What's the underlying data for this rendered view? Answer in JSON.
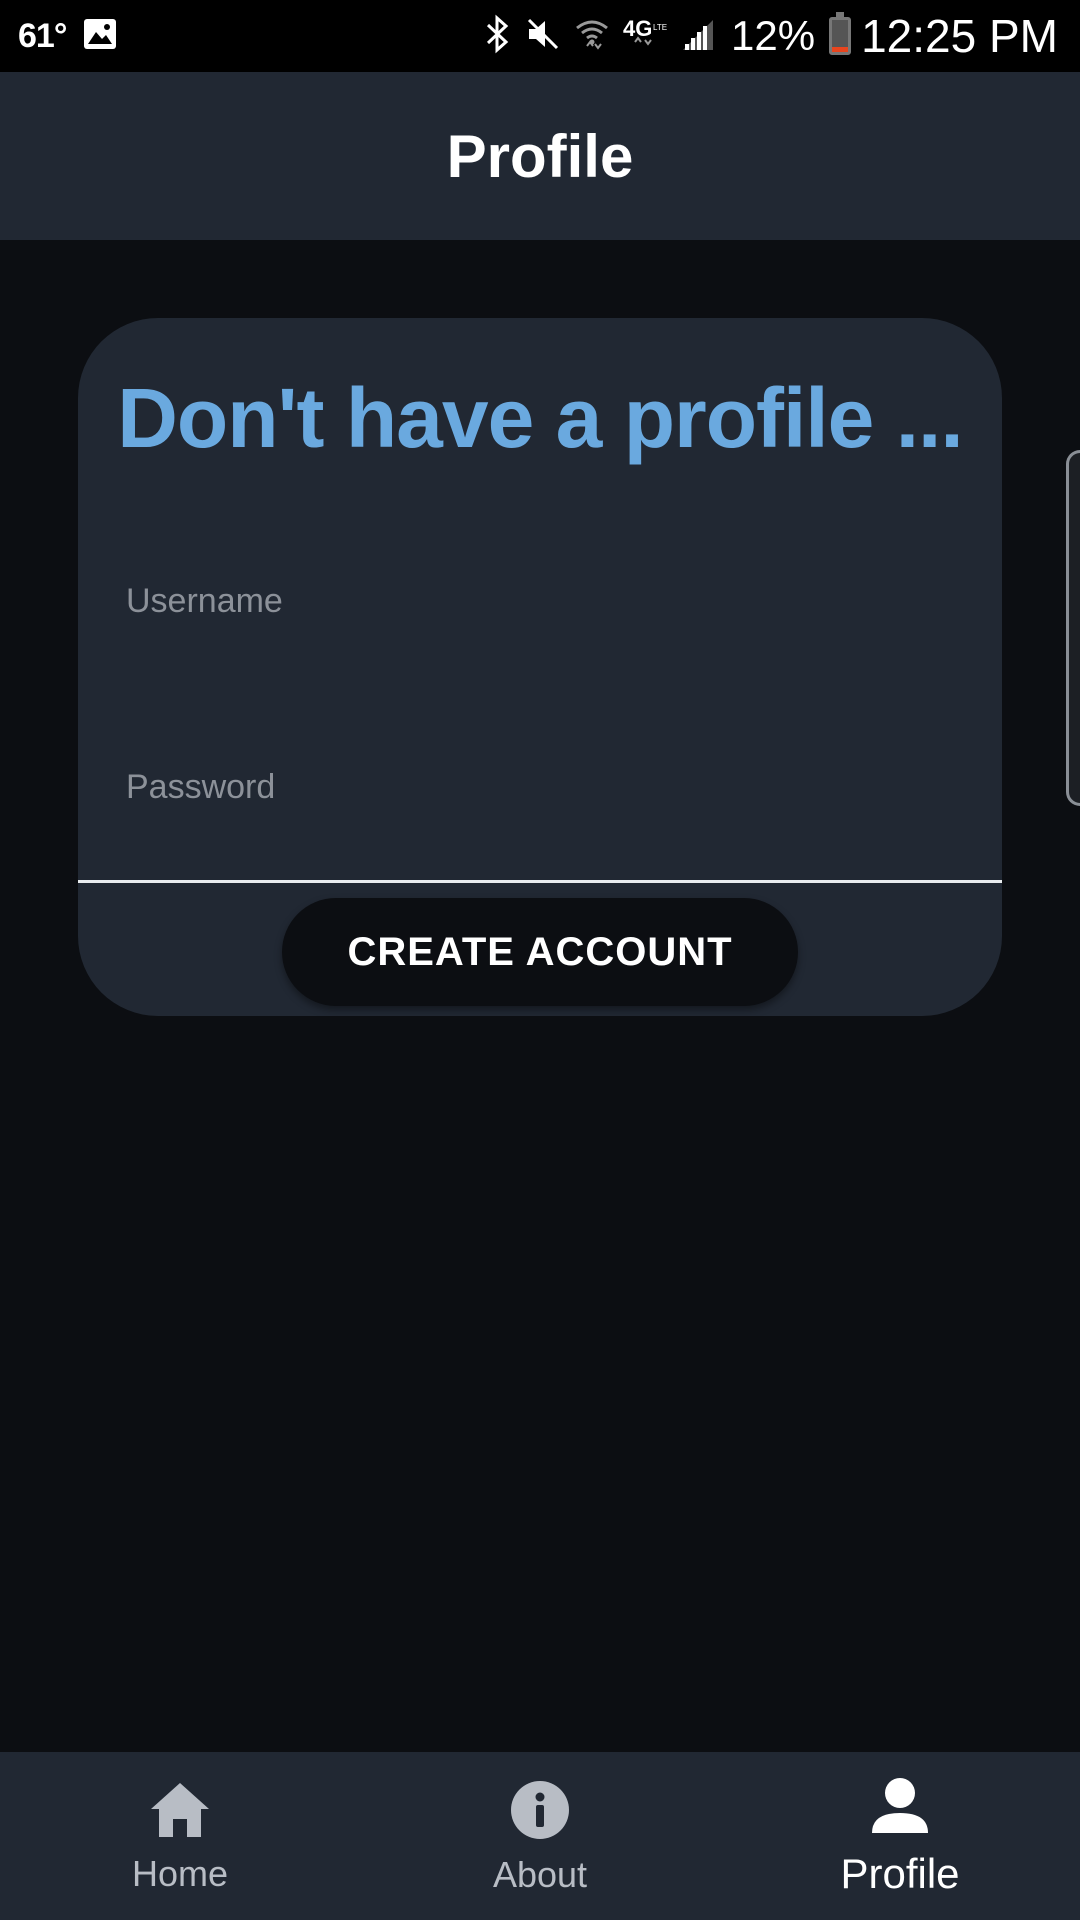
{
  "status_bar": {
    "temperature": "61°",
    "battery_percent": "12%",
    "time": "12:25 PM"
  },
  "header": {
    "title": "Profile"
  },
  "card": {
    "title": "Don't have a profile ...",
    "username_placeholder": "Username",
    "password_placeholder": "Password",
    "create_button": "CREATE ACCOUNT"
  },
  "bottom_nav": {
    "items": [
      {
        "label": "Home",
        "icon": "home-icon"
      },
      {
        "label": "About",
        "icon": "info-icon"
      },
      {
        "label": "Profile",
        "icon": "person-icon",
        "active": true
      }
    ]
  },
  "colors": {
    "accent": "#6aa9df",
    "surface": "#212833",
    "background": "#0c0e12"
  }
}
